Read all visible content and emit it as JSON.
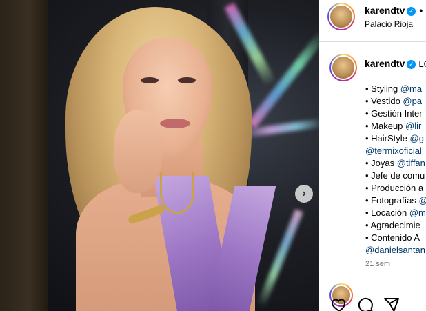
{
  "post": {
    "username": "karendtv",
    "location": "Palacio Rioja",
    "header_separator": "•",
    "caption_prefix": "LO",
    "caption_lines": [
      {
        "text": "• Styling ",
        "mention": "@ma"
      },
      {
        "text": "• Vestido ",
        "mention": "@pa"
      },
      {
        "text": "• Gestión Inter",
        "mention": ""
      },
      {
        "text": "• Makeup ",
        "mention": "@lir"
      },
      {
        "text": "• HairStyle ",
        "mention": "@g"
      },
      {
        "text": "",
        "mention": "@termixoficial"
      },
      {
        "text": "• Joyas ",
        "mention": "@tiffan"
      },
      {
        "text": "• Jefe de comu",
        "mention": ""
      },
      {
        "text": "• Producción a",
        "mention": ""
      },
      {
        "text": "• Fotografías ",
        "mention": "@"
      },
      {
        "text": "• Locación ",
        "mention": "@m"
      },
      {
        "text": "• Agradecimie",
        "mention": ""
      },
      {
        "text": "• Contenido A",
        "mention": ""
      },
      {
        "text": "",
        "mention": "@danielsantan"
      }
    ],
    "timestamp": "21 sem"
  },
  "media": {
    "next_button_icon": "chevron-right-icon",
    "next_button_glyph": "›"
  },
  "actions": {
    "like_icon": "heart-icon",
    "comment_icon": "comment-icon",
    "share_icon": "send-icon"
  },
  "colors": {
    "mention": "#00376b",
    "verified": "#0095f6",
    "timestamp": "#737373"
  }
}
